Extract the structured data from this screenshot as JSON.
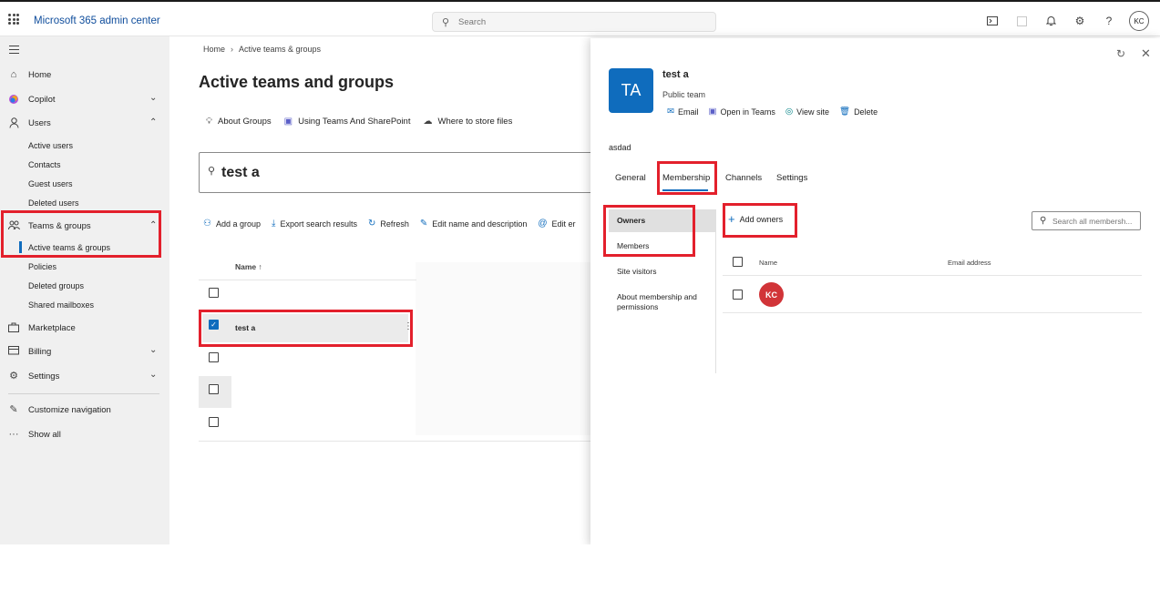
{
  "topbar": {
    "app_title": "Microsoft 365 admin center",
    "search_placeholder": "Search",
    "user_initials": "KC",
    "help_glyph": "?"
  },
  "sidebar": {
    "items": {
      "home": "Home",
      "copilot": "Copilot",
      "users": "Users",
      "teams_groups": "Teams & groups",
      "marketplace": "Marketplace",
      "billing": "Billing",
      "settings": "Settings",
      "customize": "Customize navigation",
      "show_all": "Show all"
    },
    "users_sub": [
      "Active users",
      "Contacts",
      "Guest users",
      "Deleted users"
    ],
    "teams_sub": [
      "Active teams & groups",
      "Policies",
      "Deleted groups",
      "Shared mailboxes"
    ]
  },
  "breadcrumb": {
    "home": "Home",
    "current": "Active teams & groups"
  },
  "page": {
    "title": "Active teams and groups",
    "info_links": [
      "About Groups",
      "Using Teams And SharePoint",
      "Where to store files"
    ],
    "filter_value": "test a",
    "commands": [
      "Add a group",
      "Export search results",
      "Refresh",
      "Edit name and description",
      "Edit er"
    ],
    "table": {
      "column_name": "Name",
      "sort_glyph": "↑",
      "selected_row_name": "test a"
    }
  },
  "panel": {
    "tile_initials": "TA",
    "group_name": "test a",
    "group_type": "Public team",
    "actions": [
      "Email",
      "Open in Teams",
      "View site",
      "Delete"
    ],
    "description": "asdad",
    "tabs": [
      "General",
      "Membership",
      "Channels",
      "Settings"
    ],
    "left_nav": [
      "Owners",
      "Members",
      "Site visitors",
      "About membership and permissions"
    ],
    "add_owners": "Add owners",
    "search_placeholder": "Search all membersh...",
    "columns": {
      "name": "Name",
      "email": "Email address"
    },
    "owner_initials": "KC"
  },
  "colors": {
    "accent": "#0f6cbd",
    "highlight": "#e3202c",
    "avatar": "#d13438",
    "sidebar_bg": "#f0f0f0"
  },
  "icons": [
    "waffle-icon",
    "search-icon",
    "terminal-icon",
    "bell-icon",
    "gear-icon",
    "help-icon",
    "home-icon",
    "copilot-icon",
    "person-icon",
    "people-icon",
    "bag-icon",
    "card-icon",
    "pencil-icon",
    "more-icon",
    "refresh-icon",
    "close-icon",
    "mail-icon",
    "teams-icon",
    "sharepoint-icon",
    "trash-icon",
    "plus-icon"
  ]
}
